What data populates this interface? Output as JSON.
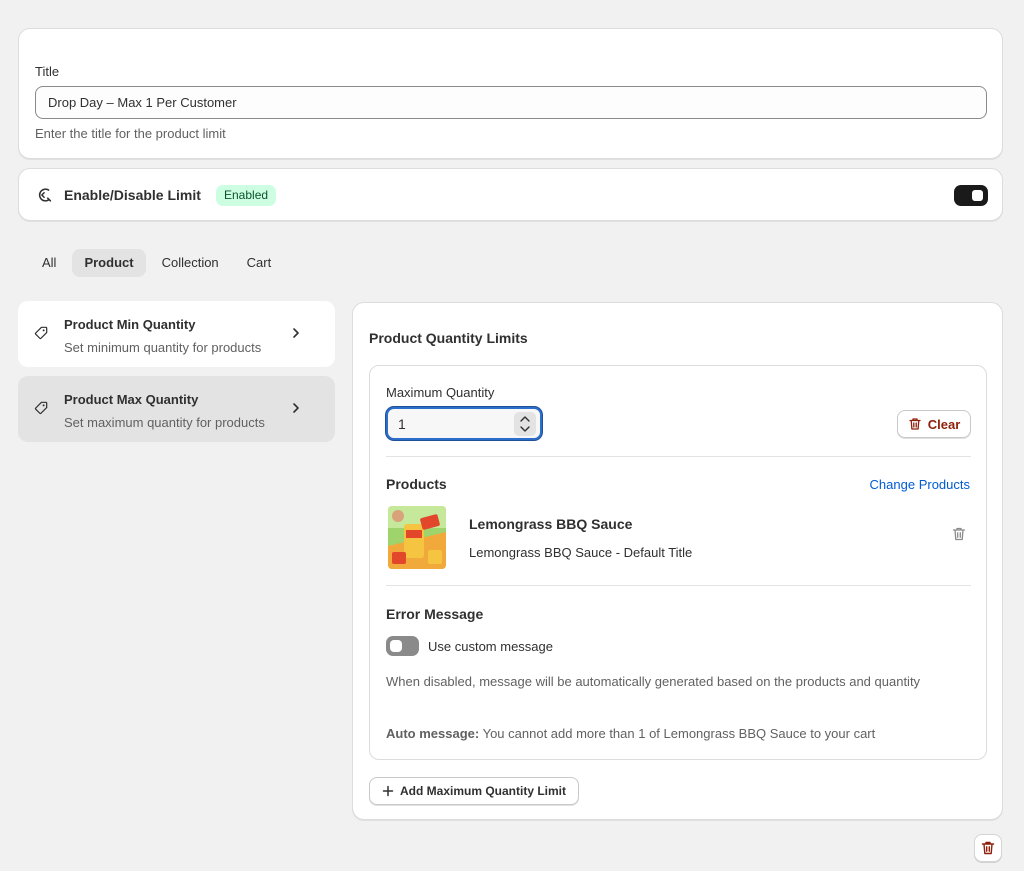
{
  "title_section": {
    "label": "Title",
    "value": "Drop Day – Max 1 Per Customer",
    "help": "Enter the title for the product limit"
  },
  "status_section": {
    "title": "Enable/Disable Limit",
    "badge": "Enabled",
    "enabled": true,
    "icon": "limit-icon"
  },
  "tabs": [
    {
      "label": "All",
      "active": false
    },
    {
      "label": "Product",
      "active": true
    },
    {
      "label": "Collection",
      "active": false
    },
    {
      "label": "Cart",
      "active": false
    }
  ],
  "sidebar": {
    "items": [
      {
        "title": "Product Min Quantity",
        "subtitle": "Set minimum quantity for products",
        "icon": "tag-icon",
        "selected": false
      },
      {
        "title": "Product Max Quantity",
        "subtitle": "Set maximum quantity for products",
        "icon": "tag-icon",
        "selected": true
      }
    ]
  },
  "main": {
    "heading": "Product Quantity Limits",
    "max_quantity_label": "Maximum Quantity",
    "max_quantity_value": "1",
    "clear_label": "Clear",
    "products_title": "Products",
    "change_products_label": "Change Products",
    "product": {
      "name": "Lemongrass BBQ Sauce",
      "variant": "Lemongrass BBQ Sauce - Default Title"
    },
    "error_title": "Error Message",
    "custom_message_label": "Use custom message",
    "custom_message_enabled": false,
    "error_description": "When disabled, message will be automatically generated based on the products and quantity",
    "auto_message_label": "Auto message:",
    "auto_message_text": "You cannot add more than 1 of Lemongrass BBQ Sauce to your cart",
    "add_limit_label": "Add Maximum Quantity Limit"
  },
  "colors": {
    "accent_blue": "#005bd3",
    "critical": "#8e1f0b",
    "badge_bg": "#cdfee1",
    "badge_text": "#0c5132"
  }
}
